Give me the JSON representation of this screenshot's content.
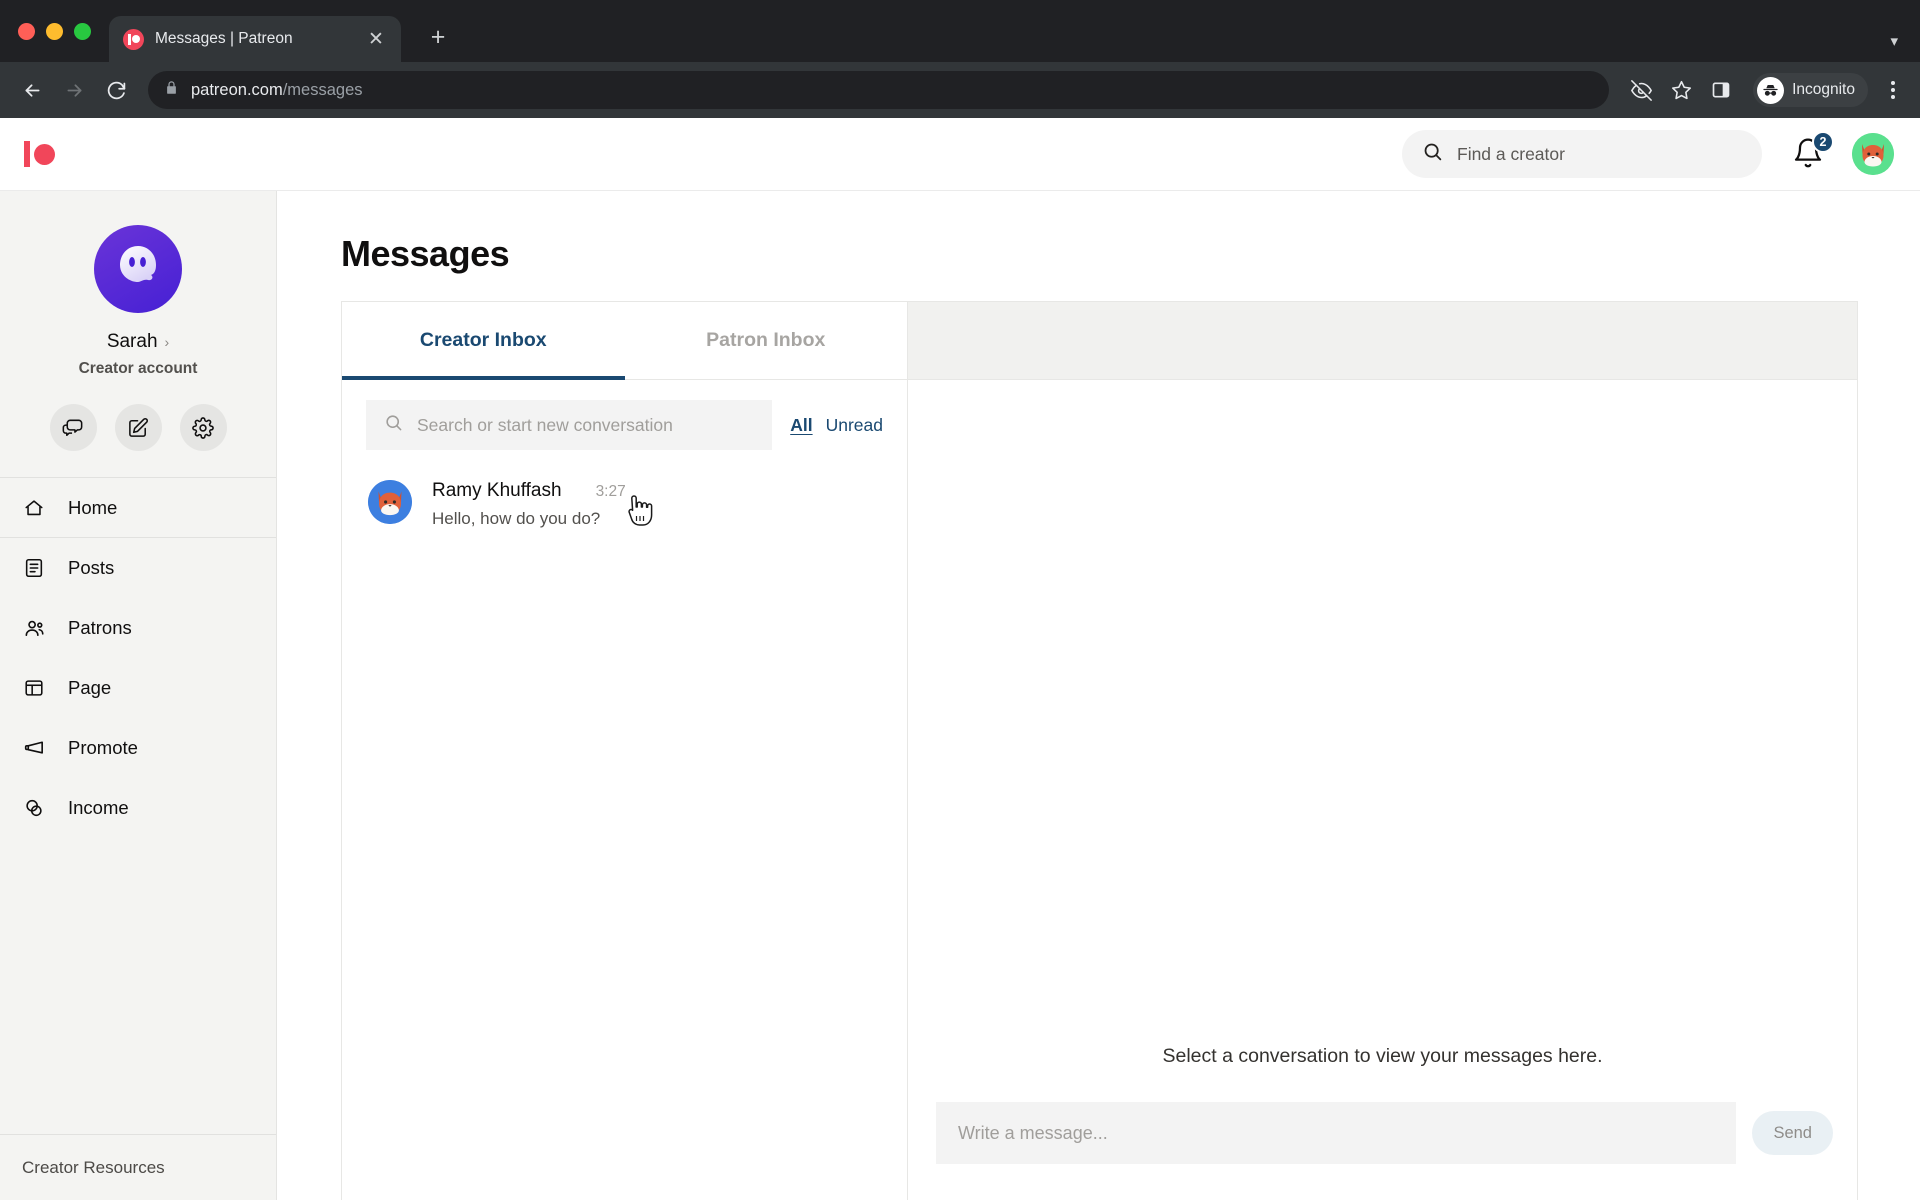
{
  "browser": {
    "tab_title": "Messages | Patreon",
    "tab_close_label": "✕",
    "new_tab_label": "+",
    "tab_list_chevron": "▾",
    "url_domain": "patreon.com",
    "url_path": "/messages",
    "profile_label": "Incognito",
    "icons": {
      "back": "back-arrow-icon",
      "forward": "forward-arrow-icon",
      "reload": "reload-icon",
      "lock": "lock-icon",
      "tracking_protection": "eye-slash-icon",
      "bookmark": "star-icon",
      "side_panel": "side-panel-icon",
      "menu": "kebab-menu-icon"
    }
  },
  "header": {
    "logo": "patreon-logo",
    "search": {
      "placeholder": "Find a creator",
      "value": ""
    },
    "notifications": {
      "count": "2",
      "icon": "bell-icon"
    },
    "avatar": "fox-avatar"
  },
  "sidebar": {
    "profile": {
      "name": "Sarah",
      "chevron": "›",
      "subtitle": "Creator account",
      "avatar": "ghost-avatar"
    },
    "actions": [
      {
        "name": "messages-button",
        "icon": "chat-bubbles-icon"
      },
      {
        "name": "compose-button",
        "icon": "edit-square-icon"
      },
      {
        "name": "settings-button",
        "icon": "gear-icon"
      }
    ],
    "items": [
      {
        "label": "Home",
        "icon": "home-icon"
      },
      {
        "label": "Posts",
        "icon": "document-icon"
      },
      {
        "label": "Patrons",
        "icon": "people-icon"
      },
      {
        "label": "Page",
        "icon": "layout-icon"
      },
      {
        "label": "Promote",
        "icon": "megaphone-icon"
      },
      {
        "label": "Income",
        "icon": "coins-icon"
      }
    ],
    "footer_label": "Creator Resources"
  },
  "main": {
    "title": "Messages",
    "tabs": [
      {
        "label": "Creator Inbox",
        "active": true
      },
      {
        "label": "Patron Inbox",
        "active": false
      }
    ],
    "search": {
      "placeholder": "Search or start new conversation",
      "value": ""
    },
    "filters": [
      {
        "label": "All",
        "active": true
      },
      {
        "label": "Unread",
        "active": false
      }
    ],
    "conversations": [
      {
        "name": "Ramy Khuffash",
        "time": "3:27",
        "preview": "Hello, how do you do?",
        "avatar": "fox-avatar"
      }
    ],
    "thread": {
      "empty_text": "Select a conversation to view your messages here.",
      "composer_placeholder": "Write a message...",
      "composer_value": "",
      "send_label": "Send"
    }
  },
  "colors": {
    "patreon_red": "#f1465a",
    "accent_navy": "#1a4971",
    "ghost_purple": "#4620d4",
    "avatar_green": "#5ae08e",
    "avatar_blue": "#3d7fe0",
    "fox_orange": "#e0603a"
  }
}
